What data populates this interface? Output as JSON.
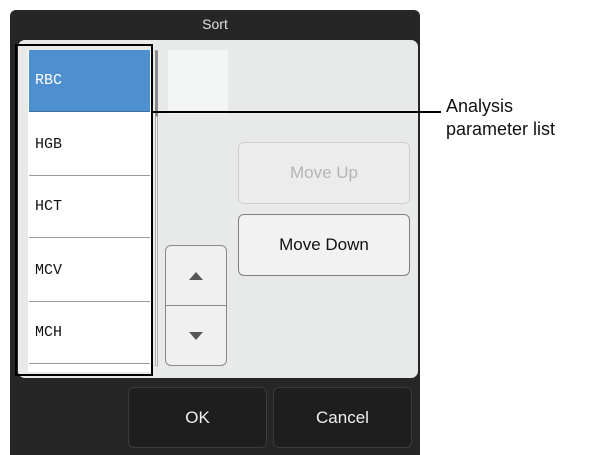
{
  "dialog": {
    "title": "Sort"
  },
  "parameter_list": {
    "items": [
      {
        "label": "RBC",
        "selected": true
      },
      {
        "label": "HGB",
        "selected": false
      },
      {
        "label": "HCT",
        "selected": false
      },
      {
        "label": "MCV",
        "selected": false
      },
      {
        "label": "MCH",
        "selected": false
      }
    ]
  },
  "buttons": {
    "move_up": "Move Up",
    "move_up_enabled": false,
    "move_down": "Move Down",
    "ok": "OK",
    "cancel": "Cancel"
  },
  "scroll_icons": {
    "up": "triangle-up-icon",
    "down": "triangle-down-icon"
  },
  "annotation": {
    "line1": "Analysis",
    "line2": "parameter list"
  },
  "colors": {
    "selected": "#4d8fcf",
    "dialog_bg": "#262626",
    "panel_bg": "#e8eaea"
  }
}
